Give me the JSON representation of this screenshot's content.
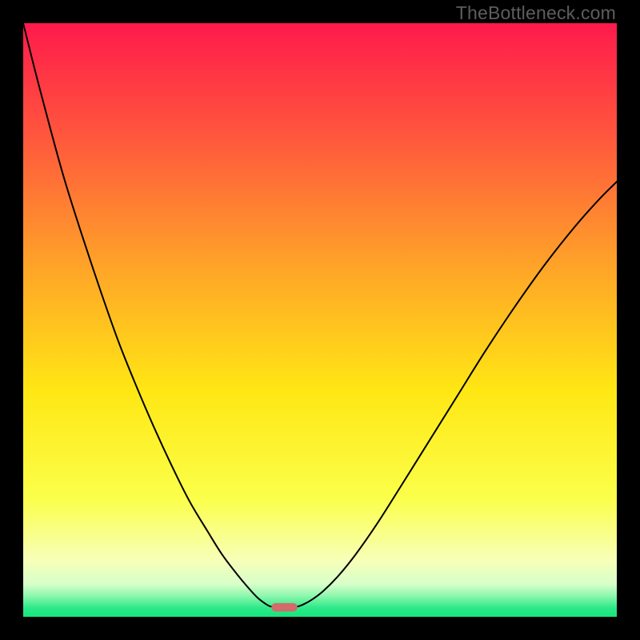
{
  "watermark": "TheBottleneck.com",
  "chart_data": {
    "type": "line",
    "title": "",
    "xlabel": "",
    "ylabel": "",
    "xlim": [
      0,
      100
    ],
    "ylim": [
      0,
      100
    ],
    "grid": false,
    "legend": false,
    "background_gradient": {
      "stops": [
        {
          "offset": 0.0,
          "color": "#ff1a4b"
        },
        {
          "offset": 0.2,
          "color": "#ff5a3c"
        },
        {
          "offset": 0.42,
          "color": "#ffa727"
        },
        {
          "offset": 0.62,
          "color": "#ffe714"
        },
        {
          "offset": 0.8,
          "color": "#fbff4a"
        },
        {
          "offset": 0.905,
          "color": "#f7ffb8"
        },
        {
          "offset": 0.945,
          "color": "#d7ffc9"
        },
        {
          "offset": 0.965,
          "color": "#8cf7ad"
        },
        {
          "offset": 0.985,
          "color": "#2de989"
        },
        {
          "offset": 1.0,
          "color": "#14e57c"
        }
      ]
    },
    "series": [
      {
        "name": "left-branch",
        "stroke": "#000000",
        "x": [
          0.0,
          2.0,
          4.5,
          7.0,
          10.0,
          13.0,
          16.0,
          19.0,
          22.0,
          25.0,
          28.0,
          31.0,
          33.5,
          36.0,
          38.0,
          39.5,
          40.8,
          41.5,
          41.9
        ],
        "y": [
          100.0,
          92.0,
          82.5,
          73.5,
          64.0,
          55.0,
          46.5,
          39.0,
          32.0,
          25.5,
          19.5,
          14.5,
          10.5,
          7.2,
          4.8,
          3.2,
          2.2,
          1.8,
          1.7
        ]
      },
      {
        "name": "right-branch",
        "stroke": "#000000",
        "x": [
          46.1,
          47.0,
          48.5,
          50.5,
          53.0,
          56.0,
          59.5,
          63.5,
          68.0,
          73.0,
          78.0,
          83.0,
          88.0,
          93.0,
          97.0,
          100.0
        ],
        "y": [
          1.7,
          2.0,
          2.8,
          4.3,
          6.8,
          10.5,
          15.5,
          21.8,
          29.0,
          37.0,
          45.0,
          52.5,
          59.5,
          65.8,
          70.3,
          73.3
        ]
      }
    ],
    "marker": {
      "name": "optimum-marker",
      "x_center": 44.0,
      "x_halfwidth": 2.2,
      "y": 1.6,
      "height": 1.4,
      "fill": "#d46a6a"
    }
  }
}
